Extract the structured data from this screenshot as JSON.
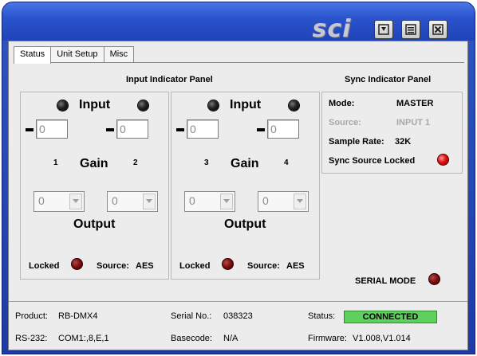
{
  "window": {
    "logo": "sci",
    "minimize_icon": "minimize-icon",
    "restore_icon": "restore-icon",
    "close_icon": "close-icon"
  },
  "tabs": [
    {
      "label": "Status",
      "active": true
    },
    {
      "label": "Unit Setup",
      "active": false
    },
    {
      "label": "Misc",
      "active": false
    }
  ],
  "input_panel": {
    "title": "Input Indicator Panel",
    "groups": [
      {
        "input_label": "Input",
        "gain_label": "Gain",
        "output_label": "Output",
        "left_channel": "1",
        "right_channel": "2",
        "left_gain": "0",
        "right_gain": "0",
        "left_output": "0",
        "right_output": "0",
        "locked_label": "Locked",
        "source_label": "Source:",
        "source_value": "AES"
      },
      {
        "input_label": "Input",
        "gain_label": "Gain",
        "output_label": "Output",
        "left_channel": "3",
        "right_channel": "4",
        "left_gain": "0",
        "right_gain": "0",
        "left_output": "0",
        "right_output": "0",
        "locked_label": "Locked",
        "source_label": "Source:",
        "source_value": "AES"
      }
    ]
  },
  "sync_panel": {
    "title": "Sync Indicator Panel",
    "mode_label": "Mode:",
    "mode_value": "MASTER",
    "source_label": "Source:",
    "source_value": "INPUT 1",
    "sample_rate_label": "Sample Rate:",
    "sample_rate_value": "32K",
    "sync_locked_label": "Sync Source Locked"
  },
  "serial_mode_label": "SERIAL MODE",
  "status_bar": {
    "product_label": "Product:",
    "product_value": "RB-DMX4",
    "serial_label": "Serial No.:",
    "serial_value": "038323",
    "status_label": "Status:",
    "status_value": "CONNECTED",
    "rs232_label": "RS-232:",
    "rs232_value": "COM1:,8,E,1",
    "basecode_label": "Basecode:",
    "basecode_value": "N/A",
    "firmware_label": "Firmware:",
    "firmware_value": "V1.008,V1.014"
  },
  "colors": {
    "title_blue": "#2a53cd",
    "connected_green": "#5ed05e",
    "sync_led_red": "#e01010",
    "locked_led_maroon": "#7a0c0c"
  }
}
